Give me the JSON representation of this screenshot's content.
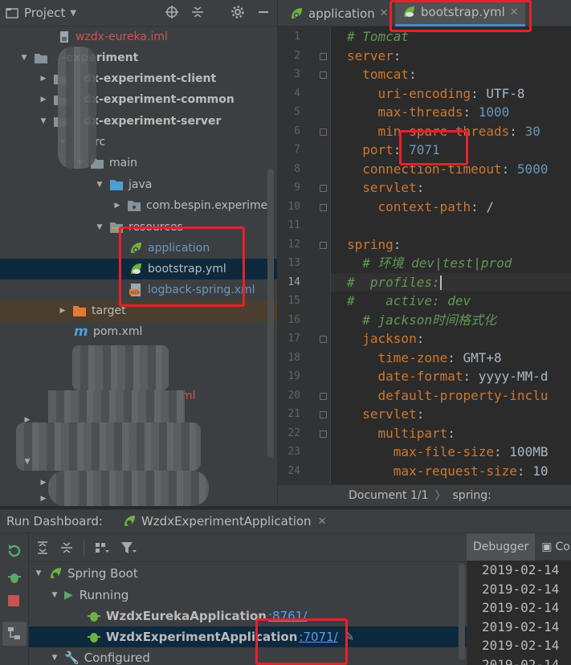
{
  "project_panel": {
    "title": "Project",
    "tree": [
      {
        "label": "wzdx-eureka.iml",
        "arrow": "",
        "icon": "iml-file-icon",
        "style": "red"
      },
      {
        "label": "-experiment",
        "arrow": "▼",
        "icon": "module-folder-icon",
        "style": "bold"
      },
      {
        "label": "dx-experiment-client",
        "arrow": "▶",
        "icon": "module-folder-icon",
        "style": "bold"
      },
      {
        "label": "dx-experiment-common",
        "arrow": "▶",
        "icon": "module-folder-icon",
        "style": "bold"
      },
      {
        "label": "dx-experiment-server",
        "arrow": "▼",
        "icon": "module-folder-icon",
        "style": "bold"
      },
      {
        "label": "rc",
        "arrow": "▼",
        "icon": "folder-icon",
        "style": ""
      },
      {
        "label": "main",
        "arrow": "▼",
        "icon": "folder-icon",
        "style": ""
      },
      {
        "label": "java",
        "arrow": "▼",
        "icon": "source-folder-icon",
        "style": ""
      },
      {
        "label": "com.bespin.experimen",
        "arrow": "▶",
        "icon": "package-icon",
        "style": ""
      },
      {
        "label": "resources",
        "arrow": "▼",
        "icon": "resources-folder-icon",
        "style": ""
      },
      {
        "label": "application",
        "arrow": "",
        "icon": "spring-properties-icon",
        "style": "blue"
      },
      {
        "label": "bootstrap.yml",
        "arrow": "",
        "icon": "spring-yml-icon",
        "style": ""
      },
      {
        "label": "logback-spring.xml",
        "arrow": "",
        "icon": "xml-file-icon",
        "style": "blue"
      },
      {
        "label": "target",
        "arrow": "▶",
        "icon": "target-folder-icon",
        "style": ""
      },
      {
        "label": "pom.xml",
        "arrow": "",
        "icon": "maven-icon",
        "style": ""
      },
      {
        "label": "ml",
        "arrow": "",
        "icon": "",
        "style": "red"
      }
    ]
  },
  "editor": {
    "tabs": [
      {
        "label": "application",
        "active": false
      },
      {
        "label": "bootstrap.yml",
        "active": true
      }
    ],
    "lines": [
      {
        "n": "1",
        "tokens": [
          [
            "c",
            "# Tomcat"
          ]
        ]
      },
      {
        "n": "2",
        "tokens": [
          [
            "k",
            "server"
          ],
          [
            "v",
            ":"
          ]
        ]
      },
      {
        "n": "3",
        "tokens": [
          [
            "v",
            "  "
          ],
          [
            "k",
            "tomcat"
          ],
          [
            "v",
            ":"
          ]
        ]
      },
      {
        "n": "4",
        "tokens": [
          [
            "v",
            "    "
          ],
          [
            "k",
            "uri-encoding"
          ],
          [
            "v",
            ": UTF-8"
          ]
        ]
      },
      {
        "n": "5",
        "tokens": [
          [
            "v",
            "    "
          ],
          [
            "k",
            "max-threads"
          ],
          [
            "v",
            ": "
          ],
          [
            "n",
            "1000"
          ]
        ]
      },
      {
        "n": "6",
        "tokens": [
          [
            "v",
            "    "
          ],
          [
            "k",
            "min-spare-threads"
          ],
          [
            "v",
            ": "
          ],
          [
            "n",
            "30"
          ]
        ]
      },
      {
        "n": "7",
        "tokens": [
          [
            "v",
            "  "
          ],
          [
            "k",
            "port"
          ],
          [
            "v",
            ": "
          ],
          [
            "n",
            "7071"
          ]
        ]
      },
      {
        "n": "8",
        "tokens": [
          [
            "v",
            "  "
          ],
          [
            "k",
            "connection-timeout"
          ],
          [
            "v",
            ": "
          ],
          [
            "n",
            "5000"
          ]
        ]
      },
      {
        "n": "9",
        "tokens": [
          [
            "v",
            "  "
          ],
          [
            "k",
            "servlet"
          ],
          [
            "v",
            ":"
          ]
        ]
      },
      {
        "n": "10",
        "tokens": [
          [
            "v",
            "    "
          ],
          [
            "k",
            "context-path"
          ],
          [
            "v",
            ": /"
          ]
        ]
      },
      {
        "n": "11",
        "tokens": []
      },
      {
        "n": "12",
        "tokens": [
          [
            "k",
            "spring"
          ],
          [
            "v",
            ":"
          ]
        ]
      },
      {
        "n": "13",
        "tokens": [
          [
            "v",
            "  "
          ],
          [
            "c",
            "# 环境 dev|test|prod"
          ]
        ]
      },
      {
        "n": "14",
        "tokens": [
          [
            "c",
            "#  profiles:"
          ]
        ]
      },
      {
        "n": "15",
        "tokens": [
          [
            "c",
            "#    active: dev"
          ]
        ]
      },
      {
        "n": "16",
        "tokens": [
          [
            "v",
            "  "
          ],
          [
            "c",
            "# jackson时间格式化"
          ]
        ]
      },
      {
        "n": "17",
        "tokens": [
          [
            "v",
            "  "
          ],
          [
            "k",
            "jackson"
          ],
          [
            "v",
            ":"
          ]
        ]
      },
      {
        "n": "18",
        "tokens": [
          [
            "v",
            "    "
          ],
          [
            "k",
            "time-zone"
          ],
          [
            "v",
            ": GMT+8"
          ]
        ]
      },
      {
        "n": "19",
        "tokens": [
          [
            "v",
            "    "
          ],
          [
            "k",
            "date-format"
          ],
          [
            "v",
            ": yyyy-MM-d"
          ]
        ]
      },
      {
        "n": "20",
        "tokens": [
          [
            "v",
            "    "
          ],
          [
            "k",
            "default-property-inclu"
          ]
        ]
      },
      {
        "n": "21",
        "tokens": [
          [
            "v",
            "  "
          ],
          [
            "k",
            "servlet"
          ],
          [
            "v",
            ":"
          ]
        ]
      },
      {
        "n": "22",
        "tokens": [
          [
            "v",
            "    "
          ],
          [
            "k",
            "multipart"
          ],
          [
            "v",
            ":"
          ]
        ]
      },
      {
        "n": "23",
        "tokens": [
          [
            "v",
            "      "
          ],
          [
            "k",
            "max-file-size"
          ],
          [
            "v",
            ": 100MB"
          ]
        ]
      },
      {
        "n": "24",
        "tokens": [
          [
            "v",
            "      "
          ],
          [
            "k",
            "max-request-size"
          ],
          [
            "v",
            ": 10"
          ]
        ]
      }
    ],
    "current_line": "14",
    "status": {
      "document": "Document 1/1",
      "path": "spring:"
    }
  },
  "run_dashboard": {
    "title": "Run Dashboard:",
    "tab_label": "WzdxExperimentApplication",
    "tree": {
      "root": "Spring Boot",
      "running": "Running",
      "apps": [
        {
          "name": "WzdxEurekaApplication",
          "port": ":8761/"
        },
        {
          "name": "WzdxExperimentApplication",
          "port": ":7071/"
        }
      ],
      "configured": "Configured"
    }
  },
  "debugger": {
    "tabs": [
      "Debugger",
      "Co"
    ],
    "log_lines": [
      "2019-02-14",
      "2019-02-14",
      "2019-02-14",
      "2019-02-14",
      "2019-02-14",
      "2019-02-14"
    ]
  },
  "colors": {
    "annotation": "#e8202a",
    "spring_green": "#6db33f",
    "keyword": "#cc7832",
    "comment": "#629755"
  }
}
